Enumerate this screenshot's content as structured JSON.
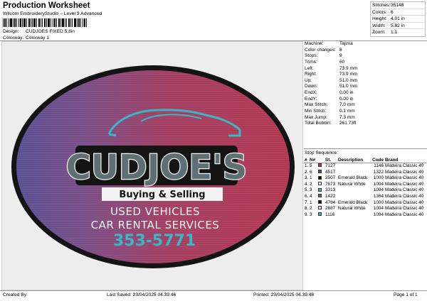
{
  "header": {
    "title": "Production Worksheet",
    "subtitle": "Wilcom EmbroideryStudio – Level 3 Advanced",
    "design_label": "Design:",
    "design_value": "CUDJOES FIXED 5,8in",
    "colorway_label": "Colorway:",
    "colorway_value": "Colorway 1"
  },
  "stats": [
    {
      "label": "Stitches:",
      "value": "35148"
    },
    {
      "label": "Colors:",
      "value": "6"
    },
    {
      "label": "Height:",
      "value": "4.01 in"
    },
    {
      "label": "Width:",
      "value": "5.82 in"
    },
    {
      "label": "Zoom:",
      "value": "1:1"
    }
  ],
  "machine": [
    {
      "label": "Machine:",
      "value": "Tajima"
    },
    {
      "label": "Color changes:",
      "value": "8"
    },
    {
      "label": "Stops:",
      "value": "9"
    },
    {
      "label": "Trims:",
      "value": "60"
    },
    {
      "label": "Left:",
      "value": "73.9 mm"
    },
    {
      "label": "Right:",
      "value": "73.9 mm"
    },
    {
      "label": "Up:",
      "value": "51.0 mm"
    },
    {
      "label": "Down:",
      "value": "51.0 mm"
    },
    {
      "label": "EndX:",
      "value": "0.00 in"
    },
    {
      "label": "EndY:",
      "value": "0.00 in"
    },
    {
      "label": "Max Stitch:",
      "value": "7.0 mm"
    },
    {
      "label": "Min Stitch:",
      "value": "0.1 mm"
    },
    {
      "label": "Max Jump:",
      "value": "7.3 mm"
    },
    {
      "label": "Total Bobbin:",
      "value": "261.73ft"
    }
  ],
  "sequence": {
    "title": "Stop Sequence:",
    "headers": {
      "n": "#",
      "no": "N#",
      "st": "St.",
      "desc": "Description",
      "code": "Code",
      "brand": "Brand"
    },
    "rows": [
      {
        "n": "1.",
        "no": "5",
        "color": "#c0334a",
        "st": "7127",
        "desc": "",
        "code": "1146",
        "brand": "Madeira Classic 40"
      },
      {
        "n": "2.",
        "no": "6",
        "color": "#4c4a8e",
        "st": "4517",
        "desc": "",
        "code": "1322",
        "brand": "Madeira Classic 40"
      },
      {
        "n": "3.",
        "no": "1",
        "color": "#111111",
        "st": "2507",
        "desc": "Emerald Black",
        "code": "1000",
        "brand": "Madeira Classic 40"
      },
      {
        "n": "4.",
        "no": "2",
        "color": "#f4f4f4",
        "st": "7673",
        "desc": "Natural White",
        "code": "1004",
        "brand": "Madeira Classic 40"
      },
      {
        "n": "5.",
        "no": "3",
        "color": "#3ab7c4",
        "st": "3313",
        "desc": "",
        "code": "1094",
        "brand": "Madeira Classic 40"
      },
      {
        "n": "6.",
        "no": "4",
        "color": "#5a6c72",
        "st": "1422",
        "desc": "",
        "code": "1364",
        "brand": "Madeira Classic 40"
      },
      {
        "n": "7.",
        "no": "1",
        "color": "#111111",
        "st": "4784",
        "desc": "Emerald Black",
        "code": "1000",
        "brand": "Madeira Classic 40"
      },
      {
        "n": "8.",
        "no": "2",
        "color": "#f4f4f4",
        "st": "2687",
        "desc": "Natural White",
        "code": "1004",
        "brand": "Madeira Classic 40"
      },
      {
        "n": "9.",
        "no": "3",
        "color": "#3ab7c4",
        "st": "1116",
        "desc": "",
        "code": "1094",
        "brand": "Madeira Classic 40"
      }
    ]
  },
  "design": {
    "logo_text": "CUDJOE'S",
    "tagline": "Buying & Selling",
    "line1": "USED VEHICLES",
    "line2": "CAR RENTAL SERVICES",
    "phone": "353-5771",
    "colors": {
      "red": "#b23a58",
      "purple": "#5a4f92",
      "teal": "#3ab7c4",
      "black": "#141414",
      "white": "#f2f2f2",
      "gray": "#5f6f74"
    }
  },
  "footer": {
    "created": "Created By:",
    "saved": "Last Saved: 23/04/2025 04.39.46",
    "printed": "Printed: 23/04/2025 04.39.48",
    "page": "Page 1 of 1"
  }
}
